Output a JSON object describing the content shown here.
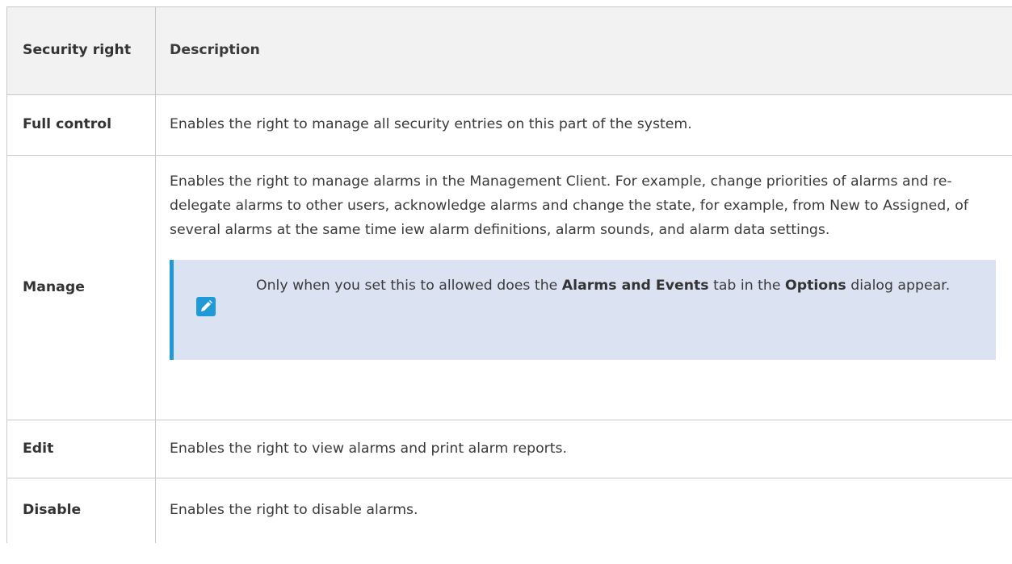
{
  "table": {
    "headers": {
      "security_right": "Security right",
      "description": "Description"
    },
    "rows": [
      {
        "right": "Full control",
        "description": "Enables the right to manage all security entries on this part of the system."
      },
      {
        "right": "Manage",
        "description": "Enables the right to manage alarms in the Management Client. For example, change priorities of alarms and re-delegate alarms to other users, acknowledge alarms and change the state, for example, from New to Assigned, of several alarms at the same time iew alarm definitions, alarm sounds, and alarm data settings.",
        "note": {
          "icon": "pencil-icon",
          "text_1": "Only when you set this to allowed does the ",
          "bold_1": "Alarms and Events",
          "text_2": " tab in the ",
          "bold_2": "Options",
          "text_3": " dialog appear."
        }
      },
      {
        "right": "Edit",
        "description": "Enables the right to view alarms and print alarm reports."
      },
      {
        "right": "Disable",
        "description": "Enables the right to disable alarms."
      }
    ]
  },
  "colors": {
    "note_background": "#dbe3f2",
    "note_accent": "#1f9ad6",
    "header_background": "#f2f2f2"
  }
}
